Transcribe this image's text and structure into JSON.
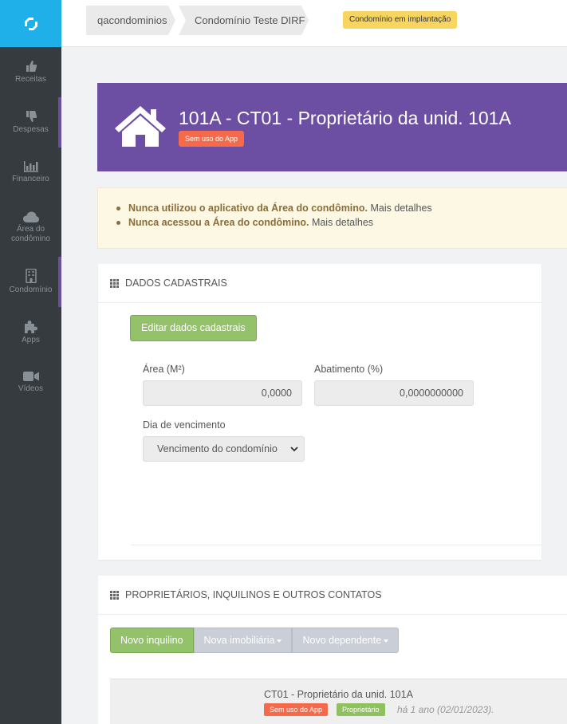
{
  "sidebar": {
    "items": [
      {
        "label": "Receitas",
        "icon": "thumbs-up-icon"
      },
      {
        "label": "Despesas",
        "icon": "thumbs-down-icon"
      },
      {
        "label": "Financeiro",
        "icon": "bar-chart-icon"
      },
      {
        "label": "Área do condômino",
        "icon": "cloud-icon"
      },
      {
        "label": "Condomínio",
        "icon": "building-icon"
      },
      {
        "label": "Apps",
        "icon": "puzzle-icon"
      },
      {
        "label": "Vídeos",
        "icon": "video-camera-icon"
      }
    ]
  },
  "breadcrumb": {
    "items": [
      "qacondominios",
      "Condomínio Teste DIRF"
    ],
    "status_badge": "Condomínio em implantação"
  },
  "header": {
    "title": "101A - CT01 - Proprietário da unid. 101A",
    "badge": "Sem uso do App"
  },
  "alert": {
    "items": [
      {
        "strong": "Nunca utilizou o aplicativo da Área do condômino.",
        "link": "Mais detalhes"
      },
      {
        "strong": "Nunca acessou a Área do condômino.",
        "link": "Mais detalhes"
      }
    ]
  },
  "dados_cadastrais": {
    "title": "DADOS CADASTRAIS",
    "edit_button": "Editar dados cadastrais",
    "area_label": "Área (M²)",
    "area_value": "0,0000",
    "abatimento_label": "Abatimento (%)",
    "abatimento_value": "0,0000000000",
    "vencimento_label": "Dia de vencimento",
    "vencimento_value": "Vencimento do condomínio"
  },
  "contatos": {
    "title": "PROPRIETÁRIOS, INQUILINOS E OUTROS CONTATOS",
    "buttons": [
      "Novo inquilino",
      "Nova imobiliária",
      "Novo dependente"
    ],
    "rows": [
      {
        "name": "CT01 - Proprietário da unid. 101A",
        "app_tag": "Sem uso do App",
        "role_tag": "Proprietário",
        "time": "há 1 ano (02/01/2023)."
      }
    ]
  },
  "colors": {
    "sidebar_bg": "#353b3e",
    "logo_bg": "#1fb0ea",
    "header_bg": "#6c4fa3",
    "green": "#94c26b",
    "danger": "#f56a4b",
    "warning_badge": "#f7d55e"
  }
}
